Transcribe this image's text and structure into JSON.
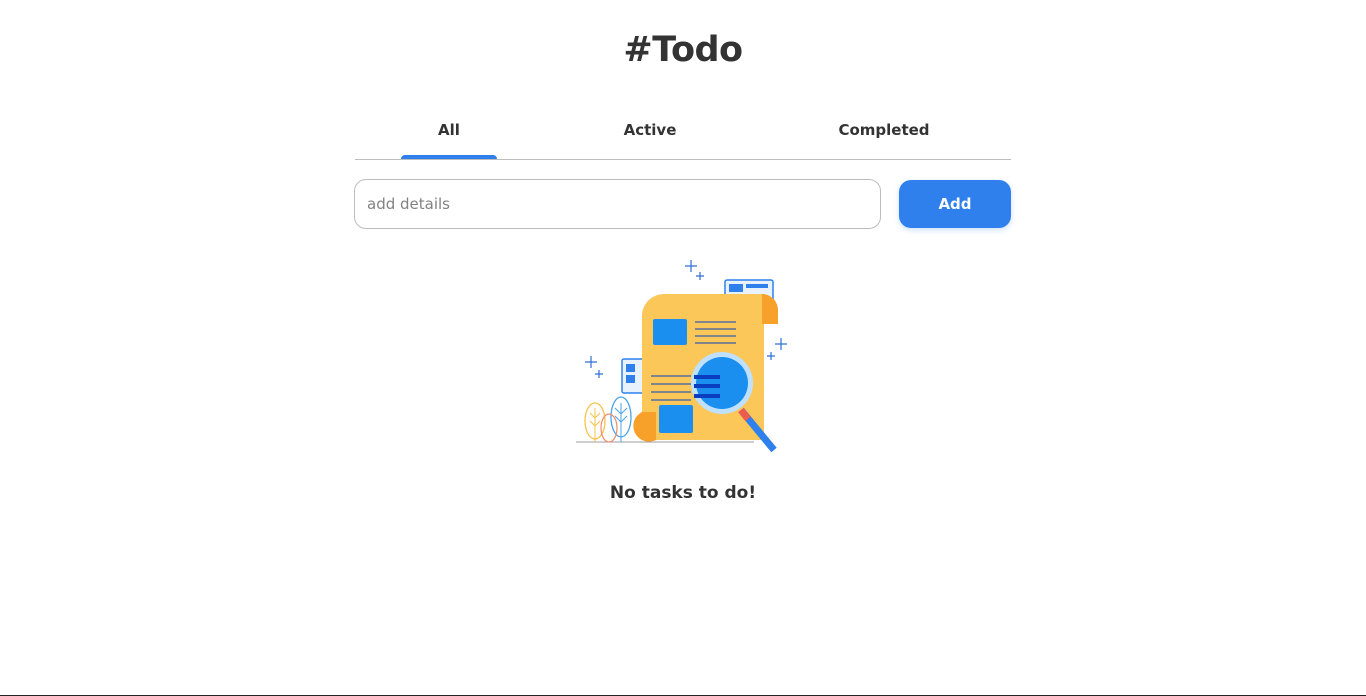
{
  "app": {
    "title": "#Todo"
  },
  "tabs": [
    {
      "label": "All",
      "selected": true
    },
    {
      "label": "Active",
      "selected": false
    },
    {
      "label": "Completed",
      "selected": false
    }
  ],
  "input": {
    "placeholder": "add details",
    "value": ""
  },
  "add_button": {
    "label": "Add"
  },
  "empty_state": {
    "message": "No tasks to do!",
    "illustration": "document-search-illustration"
  },
  "colors": {
    "accent": "#2f80ed",
    "text": "#333333",
    "border": "#bdbdbd"
  }
}
